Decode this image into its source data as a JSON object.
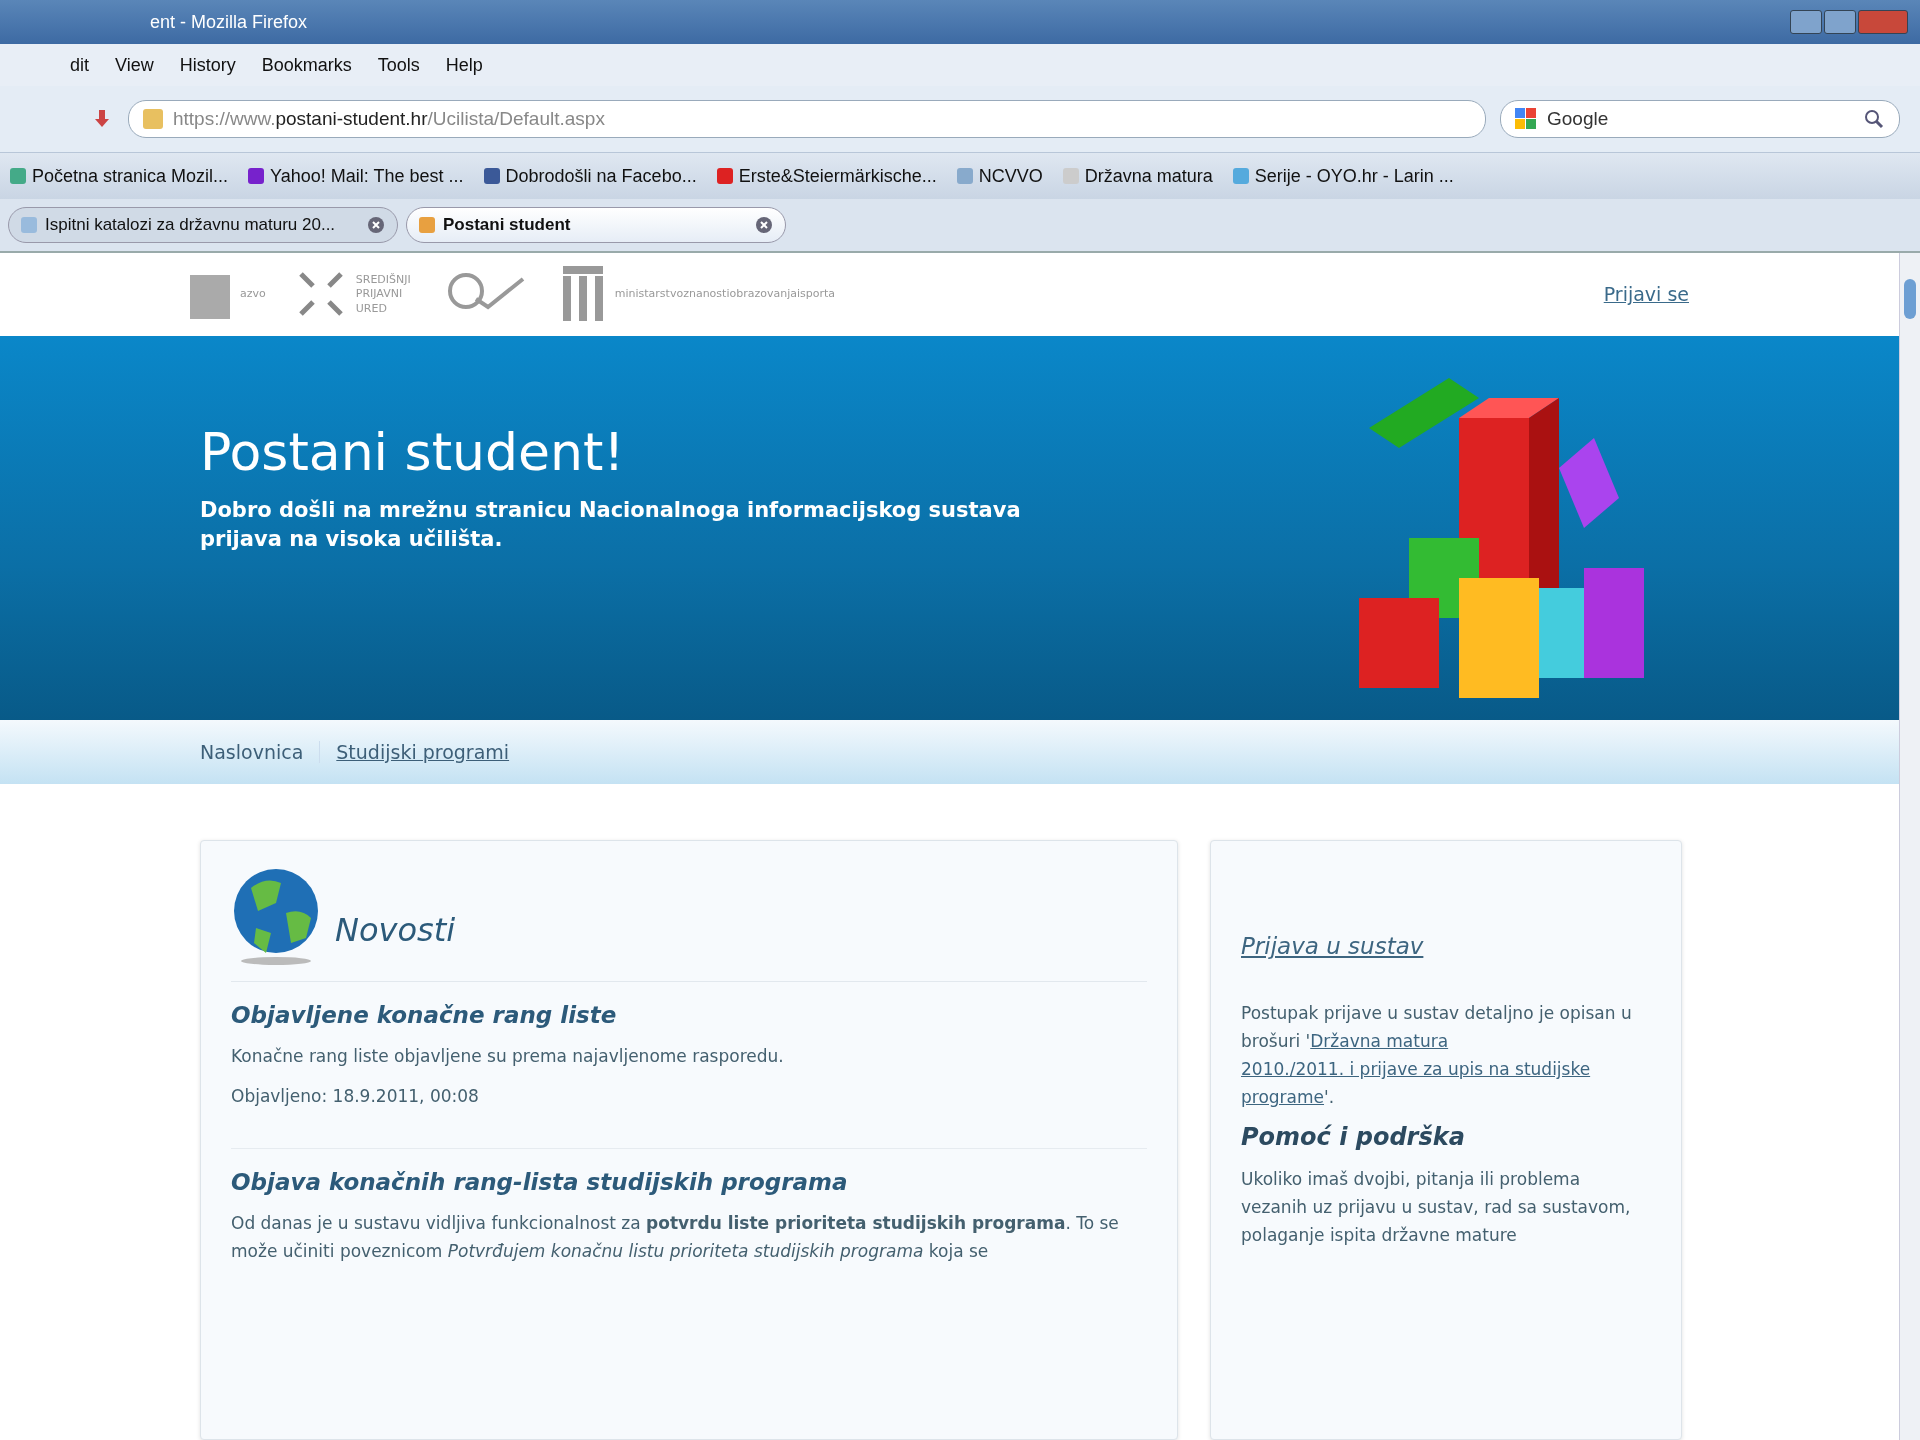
{
  "window": {
    "title": "ent - Mozilla Firefox"
  },
  "menu": [
    "dit",
    "View",
    "History",
    "Bookmarks",
    "Tools",
    "Help"
  ],
  "address": {
    "value": "https://www.**postani-student.hr**/Ucilista/Default.aspx"
  },
  "search": {
    "value": "Google"
  },
  "bookmarks": [
    "Početna stranica Mozil...",
    "Yahoo! Mail: The best ...",
    "Dobrodošli na Facebo...",
    "Erste&Steiermärkische...",
    "NCVVO",
    "Državna matura",
    "Serije - OYO.hr - Larin ..."
  ],
  "tabs": [
    {
      "label": "Ispitni katalozi za državnu maturu 20...",
      "selected": false
    },
    {
      "label": "Postani student",
      "selected": true
    }
  ],
  "page": {
    "logos": {
      "azvo": "azvo",
      "office": [
        "SREDIŠNJI",
        "PRIJAVNI",
        "URED"
      ],
      "ministry": "ministarstvoznanostiobrazovanjaisporta"
    },
    "login_link": "Prijavi se",
    "hero": {
      "title": "Postani student!",
      "subtitle": "Dobro došli na mrežnu stranicu Nacionalnoga informacijskog sustava prijava na visoka učilišta."
    },
    "nav": [
      {
        "label": "Naslovnica",
        "selected": true
      },
      {
        "label": "Studijski programi",
        "selected": false
      }
    ],
    "news": {
      "heading": "Novosti",
      "items": [
        {
          "title": "Objavljene konačne rang liste",
          "body": "Konačne rang liste objavljene su prema najavljenome rasporedu.",
          "date": "Objavljeno: 18.9.2011, 00:08"
        },
        {
          "title": "Objava konačnih rang-lista studijskih programa",
          "body": "Od danas je u sustavu vidljiva funkcionalnost za **potvrdu liste prioriteta studijskih programa**. To se može učiniti poveznicom *Potvrđujem konačnu listu prioriteta studijskih programa* koja se"
        }
      ]
    },
    "sidebar": {
      "link": "Prijava u sustav",
      "text_before": "Postupak prijave u sustav detaljno je opisan u brošuri '",
      "doc_link": [
        "Državna matura",
        "2010./2011. i prijave za upis na studijske",
        "programe"
      ],
      "text_after": "'.",
      "help_heading": "Pomoć i podrška",
      "help_text": "Ukoliko imaš dvojbi, pitanja ili problema vezanih uz prijavu u sustav, rad sa sustavom, polaganje ispita državne mature"
    }
  }
}
